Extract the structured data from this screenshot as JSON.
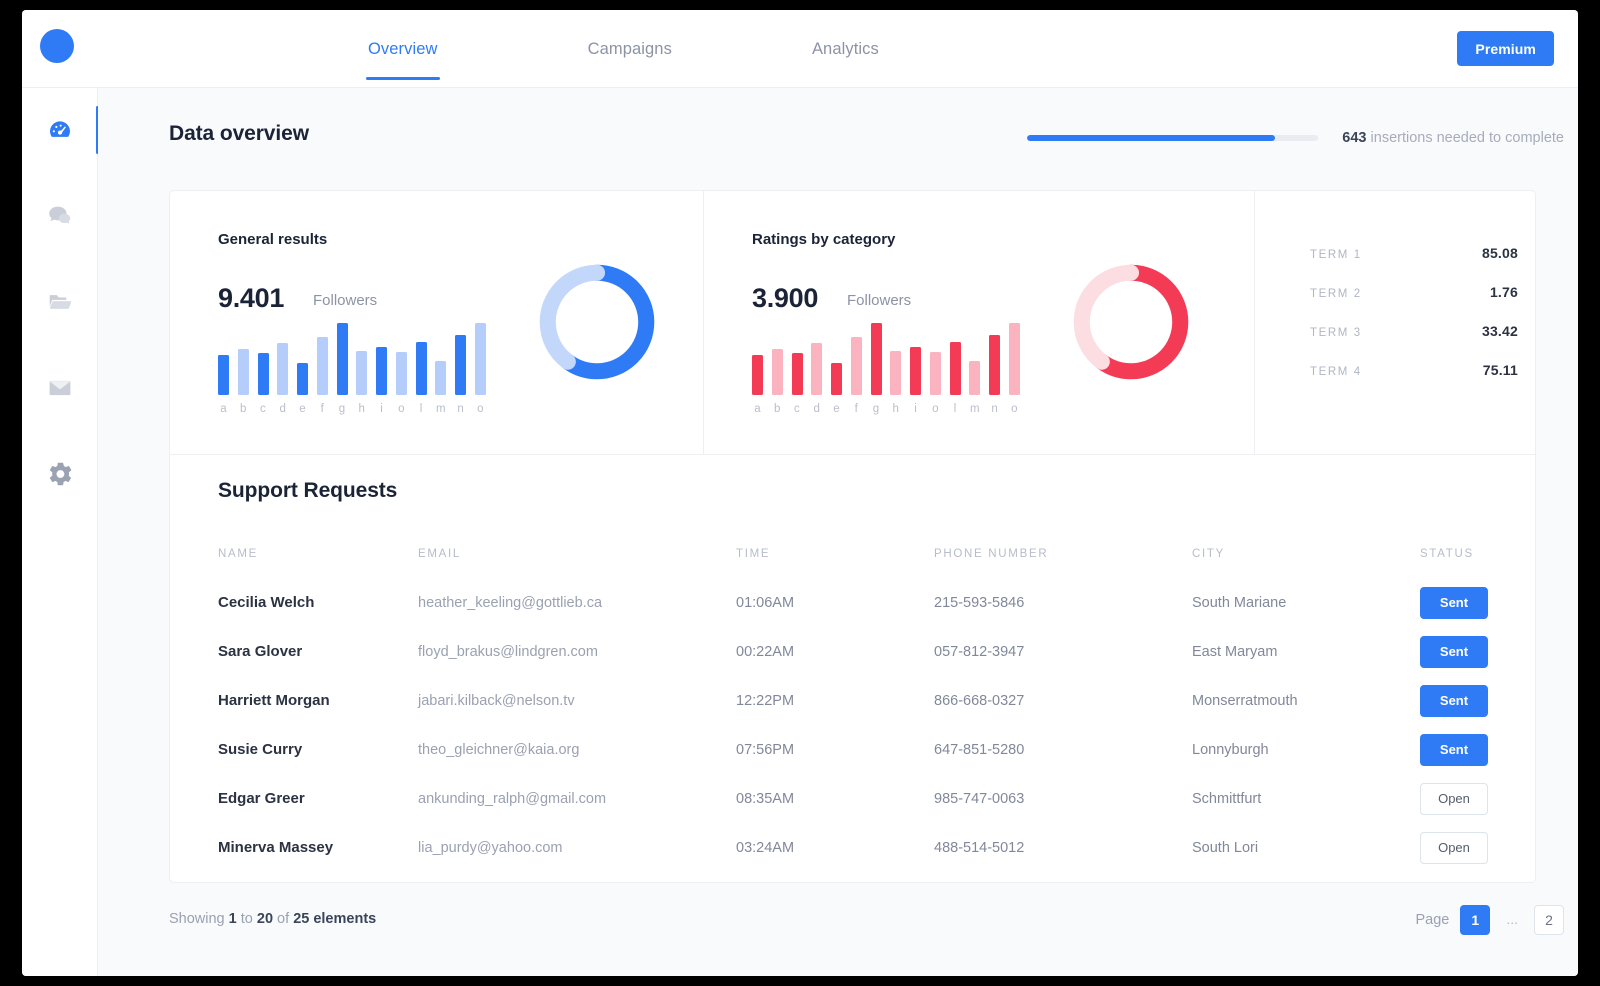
{
  "nav": {
    "logo": "logo-dot",
    "tabs": [
      {
        "label": "Overview",
        "active": true
      },
      {
        "label": "Campaigns",
        "active": false
      },
      {
        "label": "Analytics",
        "active": false
      }
    ],
    "premium_label": "Premium"
  },
  "sidebar": {
    "items": [
      {
        "icon": "dashboard-icon",
        "active": true
      },
      {
        "icon": "chat-icon",
        "active": false
      },
      {
        "icon": "folder-icon",
        "active": false
      },
      {
        "icon": "mail-icon",
        "active": false
      },
      {
        "icon": "settings-icon",
        "active": false
      }
    ]
  },
  "header": {
    "title": "Data overview",
    "progress": {
      "percent": 85,
      "count": "643",
      "text": " insertions needed to complete"
    }
  },
  "colors": {
    "accent_blue": "#2f7bf6",
    "light_blue": "#b5cdfa",
    "accent_red": "#f43b56",
    "light_red": "#fbd7dd",
    "track": "#e9ecf1"
  },
  "chart_data": [
    {
      "type": "bar",
      "title": "General results",
      "value": "9.401",
      "value_label": "Followers",
      "categories": [
        "a",
        "b",
        "c",
        "d",
        "e",
        "f",
        "g",
        "h",
        "i",
        "o",
        "l",
        "m",
        "n",
        "o"
      ],
      "values": [
        40,
        46,
        42,
        52,
        32,
        58,
        72,
        44,
        48,
        43,
        53,
        34,
        60,
        72
      ],
      "bar_colors": [
        "dark",
        "light",
        "dark",
        "light",
        "dark",
        "light",
        "dark",
        "light",
        "dark",
        "light",
        "dark",
        "light",
        "dark",
        "light"
      ],
      "ylim": [
        0,
        72
      ],
      "xlabel": "",
      "ylabel": "",
      "grid": false,
      "donut": {
        "type": "pie",
        "values": [
          60,
          40
        ],
        "colors": [
          "#2f7bf6",
          "#c3d7fb"
        ]
      }
    },
    {
      "type": "bar",
      "title": "Ratings by category",
      "value": "3.900",
      "value_label": "Followers",
      "categories": [
        "a",
        "b",
        "c",
        "d",
        "e",
        "f",
        "g",
        "h",
        "i",
        "o",
        "l",
        "m",
        "n",
        "o"
      ],
      "values": [
        40,
        46,
        42,
        52,
        32,
        58,
        72,
        44,
        48,
        43,
        53,
        34,
        60,
        72
      ],
      "bar_colors": [
        "dark",
        "light",
        "dark",
        "light",
        "dark",
        "light",
        "dark",
        "light",
        "dark",
        "light",
        "dark",
        "light",
        "dark",
        "light"
      ],
      "ylim": [
        0,
        72
      ],
      "xlabel": "",
      "ylabel": "",
      "grid": false,
      "donut": {
        "type": "pie",
        "values": [
          60,
          40
        ],
        "colors": [
          "#f43b56",
          "#fbdde2"
        ]
      }
    },
    {
      "type": "table",
      "title": "",
      "rows": [
        {
          "label": "TERM 1",
          "value": "85.08"
        },
        {
          "label": "TERM 2",
          "value": "1.76"
        },
        {
          "label": "TERM 3",
          "value": "33.42"
        },
        {
          "label": "TERM 4",
          "value": "75.11"
        }
      ]
    }
  ],
  "table": {
    "title": "Support Requests",
    "columns": [
      "NAME",
      "EMAIL",
      "TIME",
      "PHONE NUMBER",
      "CITY",
      "STATUS"
    ],
    "rows": [
      {
        "name": "Cecilia Welch",
        "email": "heather_keeling@gottlieb.ca",
        "time": "01:06AM",
        "phone": "215-593-5846",
        "city": "South Mariane",
        "status": "Sent",
        "status_type": "sent"
      },
      {
        "name": "Sara Glover",
        "email": "floyd_brakus@lindgren.com",
        "time": "00:22AM",
        "phone": "057-812-3947",
        "city": "East Maryam",
        "status": "Sent",
        "status_type": "sent"
      },
      {
        "name": "Harriett Morgan",
        "email": "jabari.kilback@nelson.tv",
        "time": "12:22PM",
        "phone": "866-668-0327",
        "city": "Monserratmouth",
        "status": "Sent",
        "status_type": "sent"
      },
      {
        "name": "Susie Curry",
        "email": "theo_gleichner@kaia.org",
        "time": "07:56PM",
        "phone": "647-851-5280",
        "city": "Lonnyburgh",
        "status": "Sent",
        "status_type": "sent"
      },
      {
        "name": "Edgar Greer",
        "email": "ankunding_ralph@gmail.com",
        "time": "08:35AM",
        "phone": "985-747-0063",
        "city": "Schmittfurt",
        "status": "Open",
        "status_type": "open"
      },
      {
        "name": "Minerva Massey",
        "email": "lia_purdy@yahoo.com",
        "time": "03:24AM",
        "phone": "488-514-5012",
        "city": "South Lori",
        "status": "Open",
        "status_type": "open"
      }
    ]
  },
  "footer": {
    "showing_prefix": "Showing ",
    "from": "1",
    "mid": " to ",
    "to": "20",
    "of": " of ",
    "total": "25 elements",
    "page_label": "Page",
    "pages": [
      {
        "label": "1",
        "active": true
      },
      {
        "label": "...",
        "active": false,
        "dots": true
      },
      {
        "label": "2",
        "active": false
      }
    ]
  }
}
